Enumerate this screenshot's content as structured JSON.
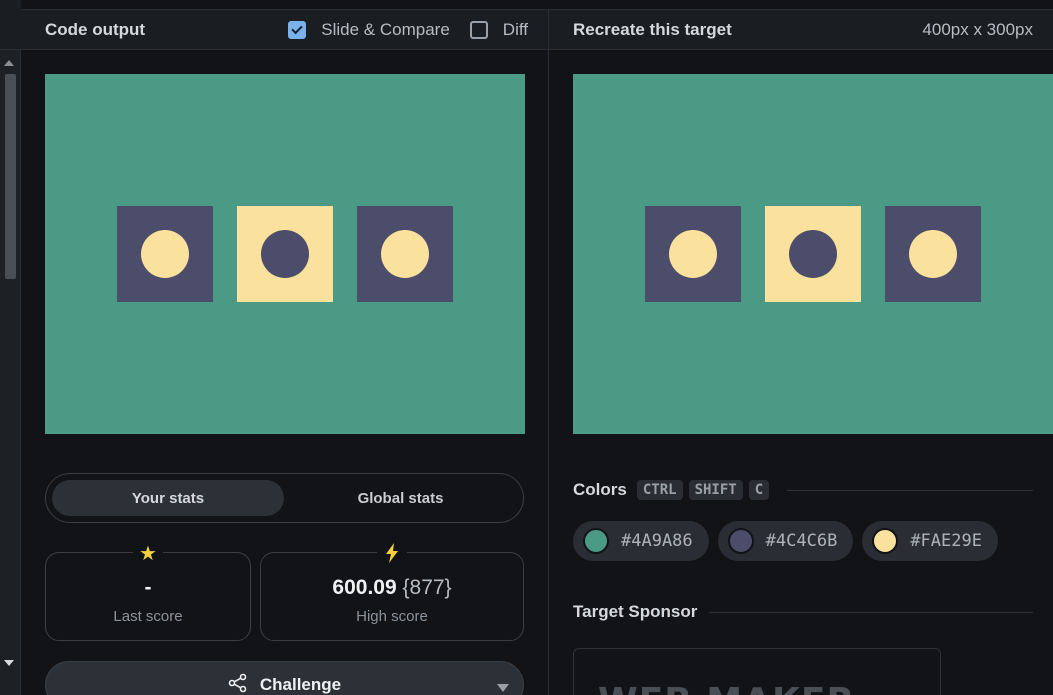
{
  "left_panel": {
    "title": "Code output",
    "slide_compare_label": "Slide & Compare",
    "slide_compare_checked": true,
    "diff_label": "Diff",
    "diff_checked": false
  },
  "right_panel": {
    "title": "Recreate this target",
    "dimensions": "400px x 300px"
  },
  "canvas": {
    "background": "#4a9a86",
    "squares": [
      {
        "square_color": "#4c4c6b",
        "circle_color": "#fae29e"
      },
      {
        "square_color": "#fae29e",
        "circle_color": "#4c4c6b"
      },
      {
        "square_color": "#4c4c6b",
        "circle_color": "#fae29e"
      }
    ]
  },
  "stats": {
    "tabs": [
      "Your stats",
      "Global stats"
    ],
    "active_tab": "Your stats",
    "last_score": {
      "value": "-",
      "label": "Last score",
      "icon": "star-icon"
    },
    "high_score": {
      "value": "600.09",
      "sub": "{877}",
      "label": "High score",
      "icon": "lightning-icon"
    }
  },
  "challenge": {
    "label": "Challenge",
    "icon": "share-icon"
  },
  "colors": {
    "title": "Colors",
    "shortcut": [
      "CTRL",
      "SHIFT",
      "C"
    ],
    "swatches": [
      {
        "hex": "#4A9A86",
        "color": "#4a9a86"
      },
      {
        "hex": "#4C4C6B",
        "color": "#4c4c6b"
      },
      {
        "hex": "#FAE29E",
        "color": "#fae29e"
      }
    ]
  },
  "sponsor": {
    "title": "Target Sponsor",
    "logo_text": "WEB MAKER"
  },
  "accent_colors": {
    "star": "#f4d03f",
    "checkbox": "#7ab1ea"
  }
}
